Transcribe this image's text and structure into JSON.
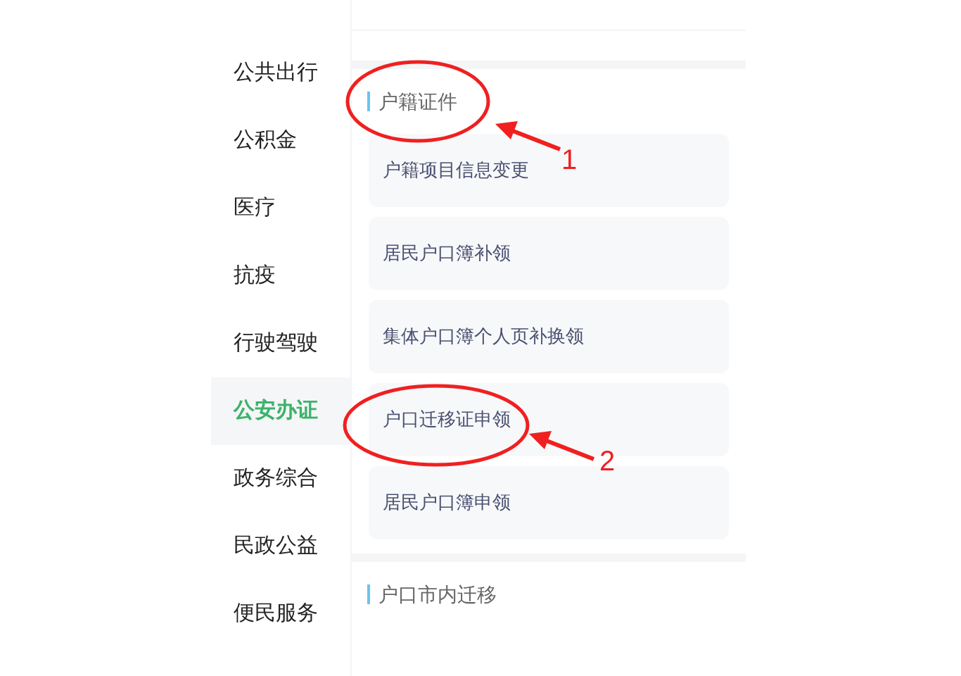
{
  "sidebar": {
    "items": [
      {
        "label": "公共出行",
        "selected": false
      },
      {
        "label": "公积金",
        "selected": false
      },
      {
        "label": "医疗",
        "selected": false
      },
      {
        "label": "抗疫",
        "selected": false
      },
      {
        "label": "行驶驾驶",
        "selected": false
      },
      {
        "label": "公安办证",
        "selected": true
      },
      {
        "label": "政务综合",
        "selected": false
      },
      {
        "label": "民政公益",
        "selected": false
      },
      {
        "label": "便民服务",
        "selected": false
      }
    ]
  },
  "sections": [
    {
      "title": "户籍证件",
      "items": [
        "户籍项目信息变更",
        "居民户口簿补领",
        "集体户口簿个人页补换领",
        "户口迁移证申领",
        "居民户口簿申领"
      ]
    },
    {
      "title": "户口市内迁移"
    }
  ],
  "annotations": [
    {
      "number": "1"
    },
    {
      "number": "2"
    }
  ]
}
